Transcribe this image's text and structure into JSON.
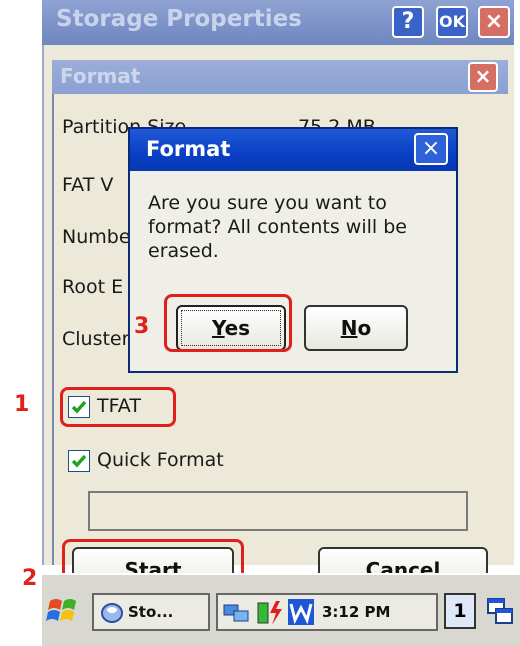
{
  "outer_window": {
    "title": "Storage Properties",
    "help_label": "?",
    "ok_label": "OK",
    "close_label": "×"
  },
  "format_dialog": {
    "title": "Format",
    "close_label": "×",
    "fields": [
      "Partition Size",
      "FAT V",
      "Numbe",
      "Root E",
      "Cluster"
    ],
    "partition_value": "75.2 MB",
    "tfat_label": "TFAT",
    "tfat_checked": true,
    "quick_format_label": "Quick Format",
    "quick_format_checked": true,
    "start_label": "Start",
    "cancel_label": "Cancel"
  },
  "confirm_dialog": {
    "title": "Format",
    "close_label": "×",
    "message": "Are you sure you want to format?  All contents will be erased.",
    "yes_label": "Yes",
    "no_label": "No"
  },
  "annotations": {
    "marker_1": "1",
    "marker_2": "2",
    "marker_3": "3",
    "color": "#e0201c"
  },
  "taskbar": {
    "app_label": "Sto...",
    "clock": "3:12 PM",
    "input_indicator": "1"
  }
}
